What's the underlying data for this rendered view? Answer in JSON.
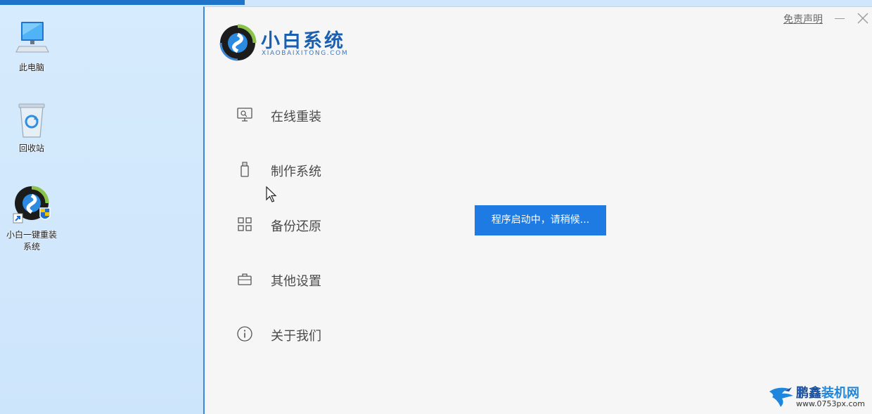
{
  "desktop": {
    "icons": [
      {
        "label": "此电脑",
        "icon": "computer-icon"
      },
      {
        "label": "回收站",
        "icon": "recycle-bin-icon"
      },
      {
        "label": "小白一键重装系统",
        "icon": "installer-shortcut-icon"
      }
    ]
  },
  "app": {
    "name": "小白系统",
    "domain": "XIAOBAIXITONG.COM",
    "disclaimer": "免责声明",
    "nav": [
      {
        "label": "在线重装",
        "icon": "monitor-icon"
      },
      {
        "label": "制作系统",
        "icon": "usb-drive-icon"
      },
      {
        "label": "备份还原",
        "icon": "grid-icon"
      },
      {
        "label": "其他设置",
        "icon": "briefcase-icon"
      },
      {
        "label": "关于我们",
        "icon": "info-icon"
      }
    ],
    "toast": "程序启动中，请稍候..."
  },
  "watermark": {
    "title_part1": "鹏鑫",
    "title_part2": "装机网",
    "url": "www.0753px.com"
  },
  "colors": {
    "accent": "#1e7be4",
    "brand": "#1a5fb0",
    "desktop": "#cfe6fb",
    "window": "#f6f6f6"
  }
}
